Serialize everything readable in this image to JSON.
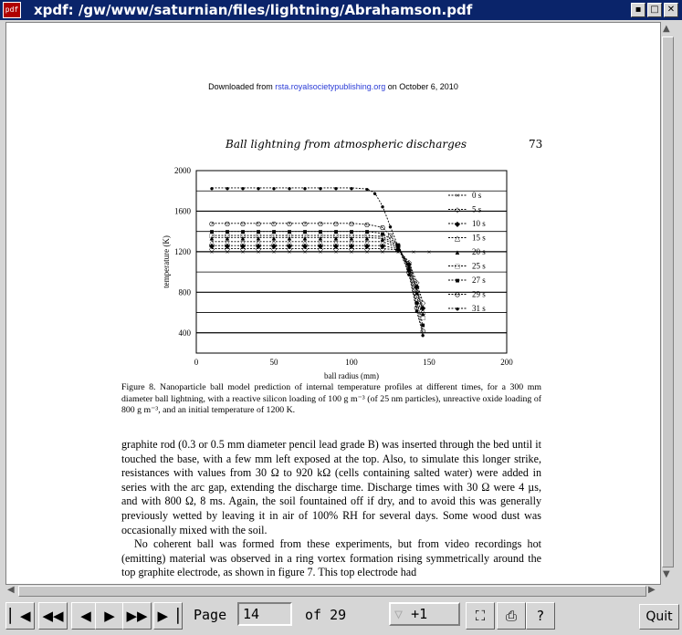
{
  "window": {
    "title": "xpdf: /gw/www/saturnian/files/lightning/Abrahamson.pdf",
    "app_icon_text": "pdf",
    "buttons": [
      "minimize",
      "maximize",
      "close"
    ]
  },
  "document": {
    "download_prefix": "Downloaded from ",
    "download_link": "rsta.royalsocietypublishing.org",
    "download_suffix": " on October 6, 2010",
    "running_head": "Ball lightning from atmospheric discharges",
    "page_number": "73",
    "caption": "Figure 8. Nanoparticle ball model prediction of internal temperature profiles at different times, for a 300 mm diameter ball lightning, with a reactive silicon loading of 100 g m⁻³ (of 25 nm particles), unreactive oxide loading of 800 g m⁻³, and an initial temperature of 1200 K.",
    "paragraphs": [
      "graphite rod (0.3 or 0.5 mm diameter pencil lead grade B) was inserted through the bed until it touched the base, with a few mm left exposed at the top. Also, to simulate this longer strike, resistances with values from 30 Ω to 920 kΩ (cells containing salted water) were added in series with the arc gap, extending the discharge time. Discharge times with 30 Ω were 4 µs, and with 800 Ω, 8 ms. Again, the soil fountained off if dry, and to avoid this was generally previously wetted by leaving it in air of 100% RH for several days. Some wood dust was occasionally mixed with the soil.",
      "No coherent ball was formed from these experiments, but from video recordings hot (emitting) material was observed in a ring vortex formation rising symmetrically around the top graphite electrode, as shown in figure 7. This top electrode had"
    ]
  },
  "chart_data": {
    "type": "line",
    "xlabel": "ball radius (mm)",
    "ylabel": "temperature (K)",
    "xlim": [
      0,
      200
    ],
    "ylim": [
      200,
      2000
    ],
    "xticks": [
      0,
      50,
      100,
      150,
      200
    ],
    "yticks": [
      400,
      800,
      1200,
      1600,
      2000
    ],
    "grid": "horizontal",
    "legend_position": "right",
    "series": [
      {
        "name": "0 s",
        "marker": "×",
        "x": [
          10,
          20,
          30,
          40,
          50,
          60,
          70,
          80,
          90,
          100,
          110,
          120,
          130,
          140,
          150
        ],
        "y": [
          1200,
          1200,
          1200,
          1200,
          1200,
          1200,
          1200,
          1200,
          1200,
          1200,
          1200,
          1200,
          1200,
          1200,
          1200
        ]
      },
      {
        "name": "5 s",
        "marker": "◇",
        "x": [
          10,
          20,
          30,
          40,
          50,
          60,
          70,
          80,
          90,
          100,
          110,
          120,
          130,
          137,
          142,
          146
        ],
        "y": [
          1230,
          1230,
          1230,
          1230,
          1230,
          1230,
          1230,
          1230,
          1230,
          1230,
          1230,
          1230,
          1220,
          1100,
          900,
          700
        ]
      },
      {
        "name": "10 s",
        "marker": "◆",
        "x": [
          10,
          20,
          30,
          40,
          50,
          60,
          70,
          80,
          90,
          100,
          110,
          120,
          130,
          137,
          142,
          146
        ],
        "y": [
          1260,
          1260,
          1260,
          1260,
          1260,
          1260,
          1260,
          1260,
          1260,
          1260,
          1260,
          1260,
          1230,
          1080,
          860,
          650
        ]
      },
      {
        "name": "15 s",
        "marker": "△",
        "x": [
          10,
          20,
          30,
          40,
          50,
          60,
          70,
          80,
          90,
          100,
          110,
          120,
          130,
          137,
          142,
          146
        ],
        "y": [
          1300,
          1300,
          1300,
          1300,
          1300,
          1300,
          1300,
          1300,
          1300,
          1300,
          1300,
          1300,
          1240,
          1060,
          830,
          620
        ]
      },
      {
        "name": "20 s",
        "marker": "▲",
        "x": [
          10,
          20,
          30,
          40,
          50,
          60,
          70,
          80,
          90,
          100,
          110,
          120,
          130,
          137,
          142,
          146
        ],
        "y": [
          1340,
          1340,
          1340,
          1340,
          1340,
          1340,
          1340,
          1340,
          1340,
          1340,
          1340,
          1330,
          1250,
          1050,
          800,
          590
        ]
      },
      {
        "name": "25 s",
        "marker": "□",
        "x": [
          10,
          20,
          30,
          40,
          50,
          60,
          70,
          80,
          90,
          100,
          110,
          120,
          130,
          137,
          142,
          146
        ],
        "y": [
          1360,
          1360,
          1360,
          1360,
          1360,
          1360,
          1360,
          1360,
          1360,
          1360,
          1360,
          1350,
          1260,
          1040,
          760,
          550
        ]
      },
      {
        "name": "27 s",
        "marker": "■",
        "x": [
          10,
          20,
          30,
          40,
          50,
          60,
          70,
          80,
          90,
          100,
          110,
          120,
          130,
          137,
          142,
          146
        ],
        "y": [
          1400,
          1400,
          1400,
          1400,
          1400,
          1400,
          1400,
          1400,
          1400,
          1400,
          1400,
          1380,
          1270,
          1020,
          700,
          480
        ]
      },
      {
        "name": "29 s",
        "marker": "⊙",
        "x": [
          10,
          20,
          30,
          40,
          50,
          60,
          70,
          80,
          90,
          100,
          110,
          120,
          125,
          130,
          137,
          142,
          146
        ],
        "y": [
          1480,
          1480,
          1480,
          1480,
          1480,
          1480,
          1480,
          1480,
          1480,
          1480,
          1470,
          1440,
          1360,
          1260,
          1000,
          650,
          420
        ]
      },
      {
        "name": "31 s",
        "marker": "●",
        "x": [
          10,
          20,
          30,
          40,
          50,
          60,
          70,
          80,
          90,
          100,
          110,
          115,
          120,
          125,
          130,
          137,
          142,
          146
        ],
        "y": [
          1830,
          1830,
          1830,
          1830,
          1830,
          1830,
          1830,
          1830,
          1830,
          1830,
          1820,
          1780,
          1650,
          1450,
          1250,
          980,
          620,
          380
        ]
      }
    ]
  },
  "toolbar": {
    "page_label": "Page",
    "page_value": "14",
    "of_label": "of 29",
    "zoom_value": "+1",
    "quit_label": "Quit"
  }
}
